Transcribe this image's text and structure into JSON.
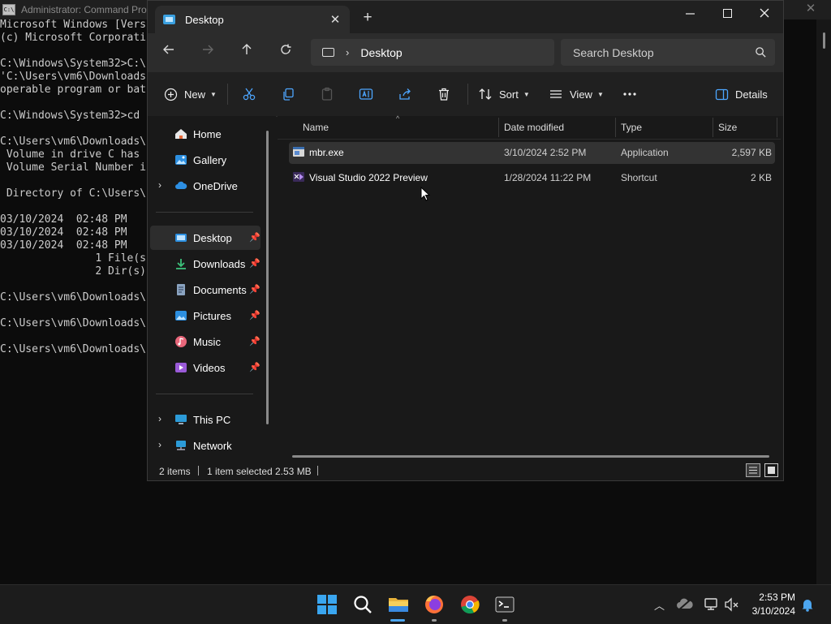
{
  "cmd": {
    "title": "Administrator: Command Prompt",
    "lines": [
      "Microsoft Windows [Vers",
      "(c) Microsoft Corporati",
      "",
      "C:\\Windows\\System32>C:\\",
      "'C:\\Users\\vm6\\Downloads",
      "operable program or bat",
      "",
      "C:\\Windows\\System32>cd",
      "",
      "C:\\Users\\vm6\\Downloads\\",
      " Volume in drive C has",
      " Volume Serial Number i",
      "",
      " Directory of C:\\Users\\",
      "",
      "03/10/2024  02:48 PM",
      "03/10/2024  02:48 PM",
      "03/10/2024  02:48 PM",
      "               1 File(s",
      "               2 Dir(s)",
      "",
      "C:\\Users\\vm6\\Downloads\\",
      "",
      "C:\\Users\\vm6\\Downloads\\",
      "",
      "C:\\Users\\vm6\\Downloads\\"
    ]
  },
  "explorer": {
    "tab_title": "Desktop",
    "address_current": "Desktop",
    "search_placeholder": "Search Desktop",
    "toolbar": {
      "new_label": "New",
      "sort_label": "Sort",
      "view_label": "View",
      "details_label": "Details"
    },
    "nav": {
      "home": "Home",
      "gallery": "Gallery",
      "onedrive": "OneDrive",
      "desktop": "Desktop",
      "downloads": "Downloads",
      "documents": "Documents",
      "pictures": "Pictures",
      "music": "Music",
      "videos": "Videos",
      "this_pc": "This PC",
      "network": "Network"
    },
    "columns": {
      "name": "Name",
      "date_modified": "Date modified",
      "type": "Type",
      "size": "Size"
    },
    "files": [
      {
        "name": "mbr.exe",
        "date": "3/10/2024 2:52 PM",
        "type": "Application",
        "size": "2,597 KB"
      },
      {
        "name": "Visual Studio 2022 Preview",
        "date": "1/28/2024 11:22 PM",
        "type": "Shortcut",
        "size": "2 KB"
      }
    ],
    "status": {
      "count": "2 items",
      "selected": "1 item selected",
      "selected_size": "2.53 MB"
    }
  },
  "taskbar": {
    "time": "2:53 PM",
    "date": "3/10/2024"
  },
  "colors": {
    "accent": "#0078d4",
    "folder": "#f2c94c"
  }
}
